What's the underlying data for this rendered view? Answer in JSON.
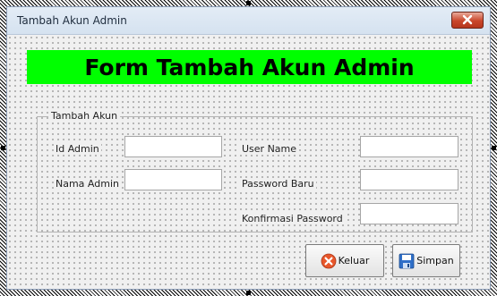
{
  "window": {
    "title": "Tambah Akun Admin",
    "close_icon": "close-icon"
  },
  "banner": {
    "text": "Form Tambah Akun Admin",
    "background": "#00ff00"
  },
  "frame": {
    "legend": "Tambah Akun"
  },
  "fields": {
    "id_admin_label": "Id Admin",
    "id_admin_value": "",
    "nama_admin_label": "Nama Admin",
    "nama_admin_value": "",
    "user_name_label": "User Name",
    "user_name_value": "",
    "password_baru_label": "Password Baru",
    "password_baru_value": "",
    "konfirmasi_label": "Konfirmasi Password",
    "konfirmasi_value": ""
  },
  "buttons": {
    "keluar_label": "Keluar",
    "keluar_icon": "exit-icon",
    "simpan_label": "Simpan",
    "simpan_icon": "save-icon"
  },
  "colors": {
    "accent": "#00ff00",
    "close": "#c9462b"
  }
}
